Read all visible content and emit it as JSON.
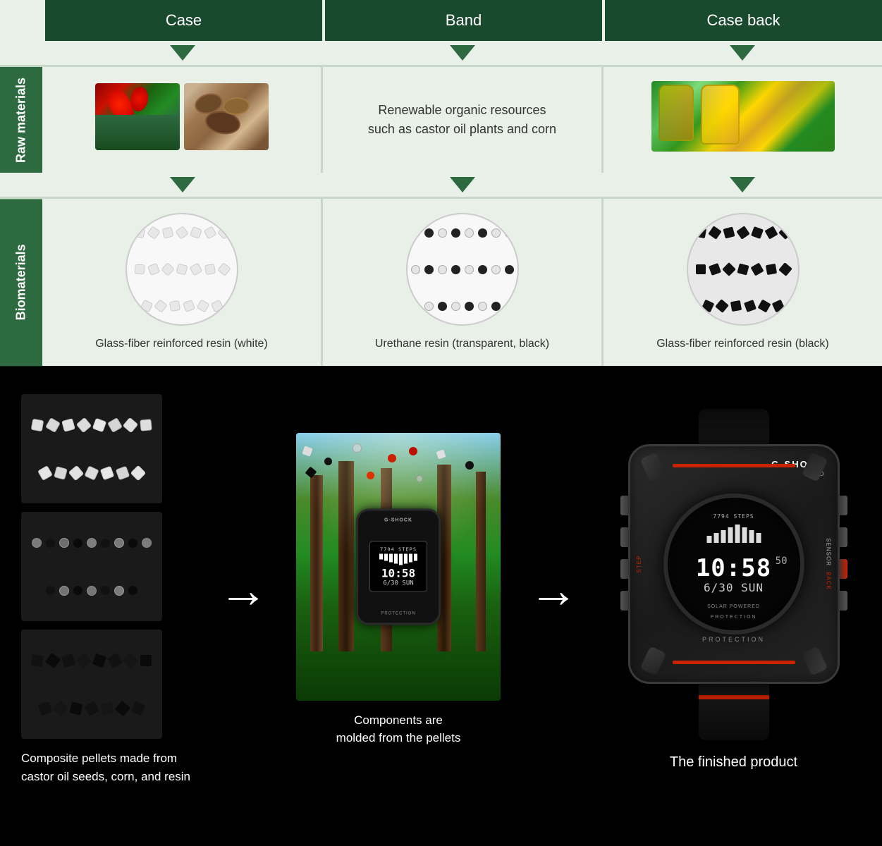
{
  "header": {
    "case_label": "Case",
    "band_label": "Band",
    "case_back_label": "Case back"
  },
  "rows": {
    "raw_materials_label": "Raw materials",
    "biomaterials_label": "Biomaterials"
  },
  "raw_materials": {
    "band_text": "Renewable organic resources\nsuch as castor oil plants and corn"
  },
  "biomaterials": {
    "case_label": "Glass-fiber reinforced resin (white)",
    "band_label": "Urethane resin (transparent, black)",
    "case_back_label": "Glass-fiber reinforced resin (black)"
  },
  "bottom": {
    "pellets_caption": "Composite pellets made from\ncastor oil seeds, corn, and resin",
    "molded_caption": "Components are\nmolded from the pellets",
    "finished_caption": "The finished product"
  },
  "watch": {
    "brand": "G-SHOCK",
    "time": "10:58",
    "seconds": "50",
    "date": "6/30 SUN",
    "steps": "7794 STEPS",
    "protection": "PROTECTION"
  }
}
